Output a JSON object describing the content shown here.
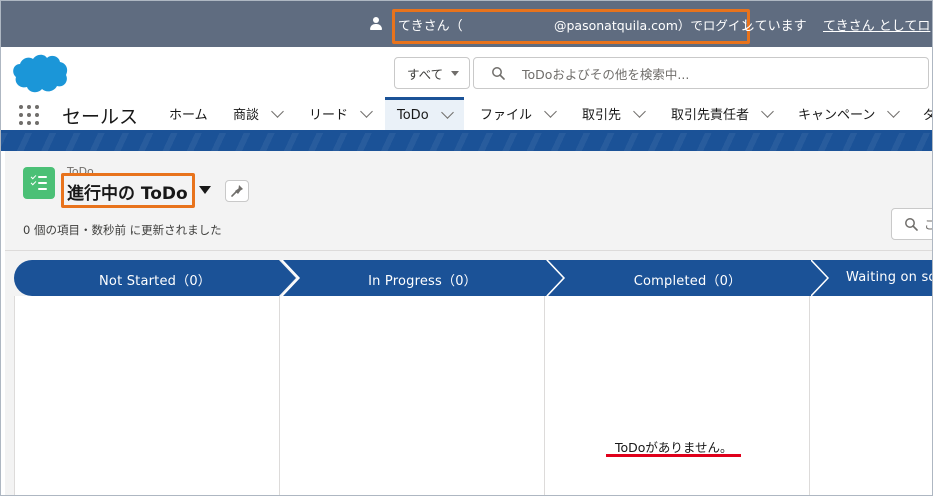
{
  "banner": {
    "login_name": "てきさん（",
    "login_email": "@pasonatquila.com）でログイン",
    "login_status": "しています",
    "login_link": "てきさん としてロ"
  },
  "header": {
    "logo": "salesforce-cloud-logo",
    "search_scope": "すべて",
    "search_placeholder": "ToDoおよびその他を検索中..."
  },
  "nav": {
    "app_name": "セールス",
    "items": [
      {
        "label": "ホーム",
        "has_menu": false,
        "active": false
      },
      {
        "label": "商談",
        "has_menu": true,
        "active": false
      },
      {
        "label": "リード",
        "has_menu": true,
        "active": false
      },
      {
        "label": "ToDo",
        "has_menu": true,
        "active": true
      },
      {
        "label": "ファイル",
        "has_menu": true,
        "active": false
      },
      {
        "label": "取引先",
        "has_menu": true,
        "active": false
      },
      {
        "label": "取引先責任者",
        "has_menu": true,
        "active": false
      },
      {
        "label": "キャンペーン",
        "has_menu": true,
        "active": false
      },
      {
        "label": "ダ",
        "has_menu": false,
        "active": false
      }
    ]
  },
  "list": {
    "object_label": "ToDo",
    "view_name": "進行中の ToDo",
    "meta": "0 個の項目・数秒前 に更新されました",
    "search_placeholder": "こ"
  },
  "kanban": {
    "stages": [
      {
        "name": "Not Started",
        "count": "（0）"
      },
      {
        "name": "In Progress",
        "count": "（0）"
      },
      {
        "name": "Completed",
        "count": "（0）"
      },
      {
        "name": "Waiting on so",
        "count": ""
      }
    ],
    "empty_message": "ToDoがありません。"
  },
  "colors": {
    "banner": "#5f6c80",
    "brand_blue": "#1b5297",
    "highlight_box": "#e8731c",
    "underline": "#e0001b",
    "todo_icon": "#4bc076"
  }
}
